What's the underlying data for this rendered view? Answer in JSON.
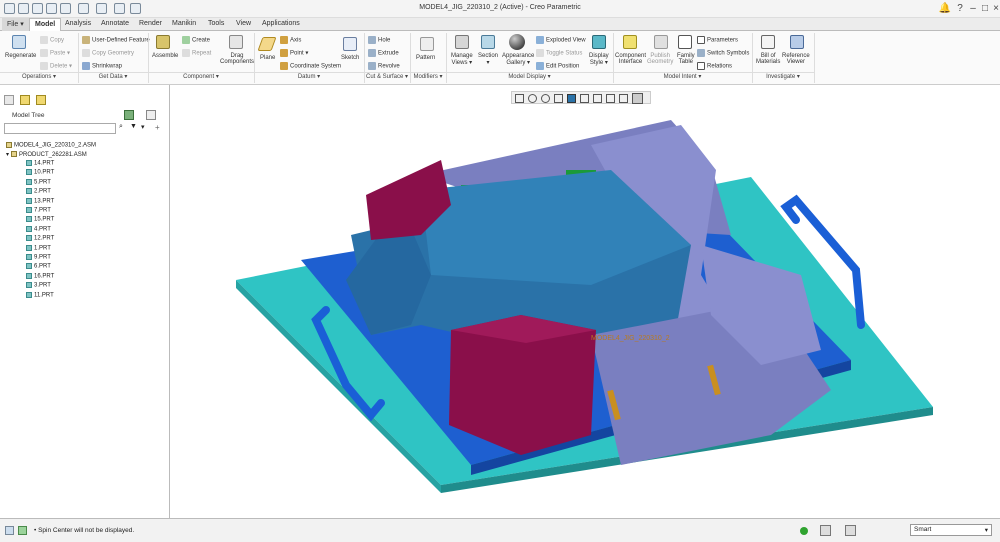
{
  "window": {
    "title": "MODEL4_JIG_220310_2 (Active) - Creo Parametric"
  },
  "tabs": [
    "File ▾",
    "Model",
    "Analysis",
    "Annotate",
    "Render",
    "Manikin",
    "Tools",
    "View",
    "Applications"
  ],
  "ribbon": {
    "regenerate": "Regenerate",
    "copy": "Copy",
    "paste": "Paste ▾",
    "delete": "Delete ▾",
    "user_defined_feature": "User-Defined Feature",
    "copy_geometry": "Copy Geometry",
    "shrinkwrap": "Shrinkwrap",
    "assemble": "Assemble",
    "create": "Create",
    "repeat": "Repeat",
    "drag_components": "Drag\nComponents",
    "plane": "Plane",
    "axis": "Axis",
    "point": "Point ▾",
    "coordinate_system": "Coordinate System",
    "sketch": "Sketch",
    "hole": "Hole",
    "extrude": "Extrude",
    "revolve": "Revolve",
    "pattern": "Pattern",
    "manage_views": "Manage\nViews ▾",
    "section": "Section\n▾",
    "appearance_gallery": "Appearance\nGallery ▾",
    "exploded_view": "Exploded View",
    "toggle_status": "Toggle Status",
    "edit_position": "Edit Position",
    "display_style": "Display\nStyle ▾",
    "component_interface": "Component\nInterface",
    "publish_geometry": "Publish\nGeometry",
    "family_table": "Family\nTable",
    "parameters": "Parameters",
    "switch_symbols": "Switch Symbols",
    "relations": "Relations",
    "bill_of_materials": "Bill of\nMaterials",
    "reference_viewer": "Reference\nViewer",
    "groups": [
      "Operations ▾",
      "Get Data ▾",
      "Component ▾",
      "Datum ▾",
      "Cut & Surface ▾",
      "Modifiers ▾",
      "Model Display ▾",
      "Model Intent ▾",
      "Investigate ▾"
    ]
  },
  "model_tree": {
    "title": "Model Tree",
    "root": "MODEL4_JIG_220310_2.ASM",
    "sub": "PRODUCT_262281.ASM",
    "parts": [
      "14.PRT",
      "10.PRT",
      "5.PRT",
      "2.PRT",
      "13.PRT",
      "7.PRT",
      "15.PRT",
      "4.PRT",
      "12.PRT",
      "1.PRT",
      "9.PRT",
      "6.PRT",
      "16.PRT",
      "3.PRT",
      "11.PRT"
    ]
  },
  "viewport": {
    "label": "MODEL4_JIG_220310_2"
  },
  "status": {
    "message": "Spin Center will not be displayed.",
    "filter": "Smart"
  },
  "colors": {
    "base": "#2fc4c4",
    "fixture": "#1e5fd0",
    "product": "#2a72a8",
    "clamp": "#8a0f4a",
    "block": "#7a7fc0",
    "handle": "#1a5fd6",
    "pin": "#c98f20"
  }
}
